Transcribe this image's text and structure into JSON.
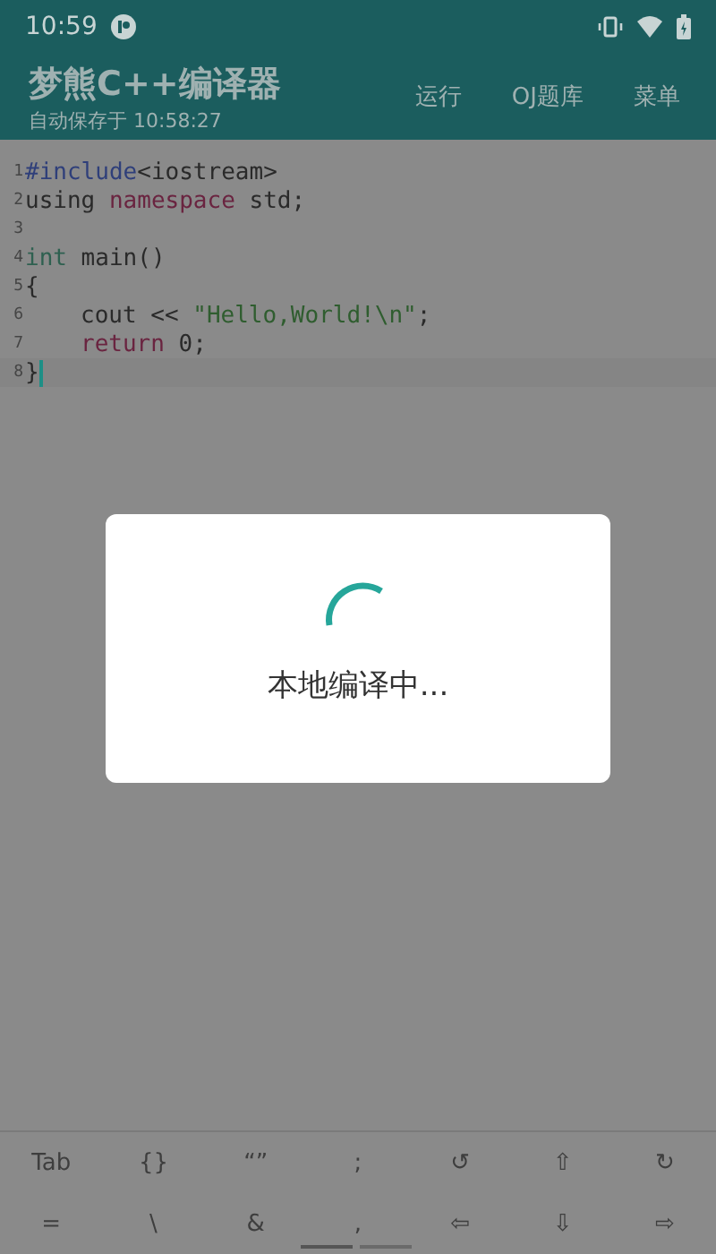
{
  "status_bar": {
    "time": "10:59"
  },
  "toolbar": {
    "title": "梦熊C++编译器",
    "subtitle": "自动保存于 10:58:27",
    "actions": [
      "运行",
      "OJ题库",
      "菜单"
    ]
  },
  "editor": {
    "lines": [
      {
        "number": "1",
        "current": false,
        "tokens": [
          {
            "kind": "preproc",
            "text": "#include"
          },
          {
            "kind": "plain",
            "text": "<iostream>"
          }
        ]
      },
      {
        "number": "2",
        "current": false,
        "tokens": [
          {
            "kind": "plain",
            "text": "using "
          },
          {
            "kind": "keyword",
            "text": "namespace"
          },
          {
            "kind": "plain",
            "text": " std;"
          }
        ]
      },
      {
        "number": "3",
        "current": false
      },
      {
        "number": "4",
        "current": false,
        "tokens": [
          {
            "kind": "type",
            "text": "int"
          },
          {
            "kind": "plain",
            "text": " main()"
          }
        ]
      },
      {
        "number": "5",
        "current": false,
        "tokens": [
          {
            "kind": "plain",
            "text": "{"
          }
        ]
      },
      {
        "number": "6",
        "current": false,
        "indented": true,
        "tokens": [
          {
            "kind": "plain",
            "text": "cout << "
          },
          {
            "kind": "string",
            "text": "\"Hello,World!\\n\""
          },
          {
            "kind": "plain",
            "text": ";"
          }
        ]
      },
      {
        "number": "7",
        "current": false,
        "indented": true,
        "tokens": [
          {
            "kind": "keyword",
            "text": "return"
          },
          {
            "kind": "plain",
            "text": " 0;"
          }
        ]
      },
      {
        "number": "8",
        "current": true,
        "tokens": [
          {
            "kind": "plain",
            "text": "}"
          }
        ]
      }
    ]
  },
  "dialog": {
    "message": "本地编译中..."
  },
  "keys": [
    "Tab",
    "{}",
    "“”",
    ";",
    "↺",
    "⇧",
    "↻",
    "=",
    "\\",
    "&",
    ",",
    "⇦",
    "⇩",
    "⇨"
  ]
}
